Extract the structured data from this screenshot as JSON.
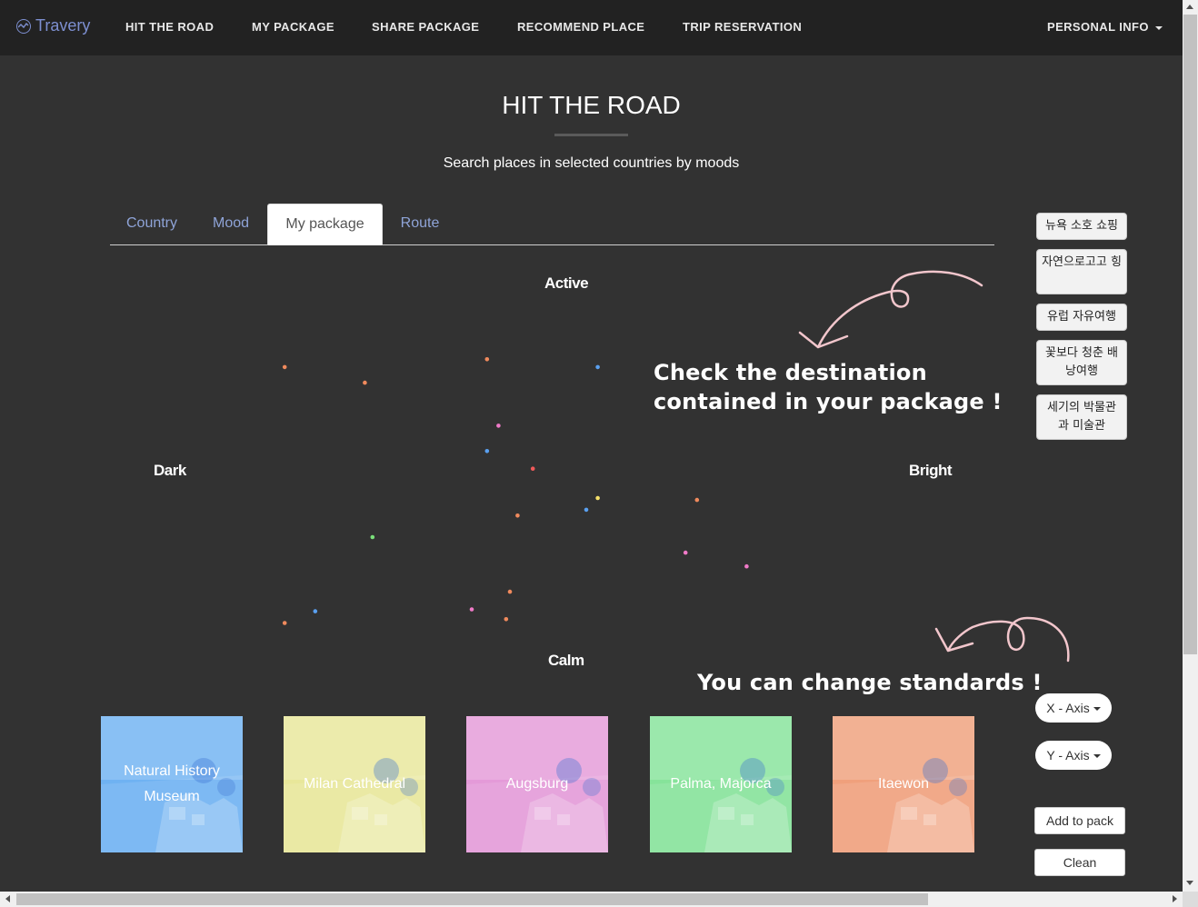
{
  "nav": {
    "brand": "Travery",
    "items": [
      "HIT THE ROAD",
      "MY PACKAGE",
      "SHARE PACKAGE",
      "RECOMMEND PLACE",
      "TRIP RESERVATION"
    ],
    "personal": "PERSONAL INFO"
  },
  "header": {
    "title": "HIT THE ROAD",
    "subtitle": "Search places in selected countries by moods"
  },
  "tabs": [
    "Country",
    "Mood",
    "My package",
    "Route"
  ],
  "active_tab": "My package",
  "axes": {
    "top": "Active",
    "bottom": "Calm",
    "left": "Dark",
    "right": "Bright"
  },
  "notes": {
    "check_line1": "Check the destination",
    "check_line2": "contained in your package !",
    "change": "You can change standards !"
  },
  "packages": [
    "뉴욕 소호 쇼핑",
    "자연으로고고 힝",
    "유럽 자유여행",
    "꽃보다 청춘 배 낭여행",
    "세기의 박물관 과 미술관"
  ],
  "controls": {
    "x_axis": "X - Axis",
    "y_axis": "Y - Axis",
    "add": "Add to pack",
    "clean": "Clean"
  },
  "cards": [
    {
      "label": "Natural History Museum",
      "color": "#6fb2f2"
    },
    {
      "label": "Milan Cathedral",
      "color": "#e8e79a"
    },
    {
      "label": "Augsburg",
      "color": "#e49ad8"
    },
    {
      "label": "Palma, Majorca",
      "color": "#86e39a"
    },
    {
      "label": "Itaewon",
      "color": "#f0a07c"
    }
  ],
  "chart_data": {
    "type": "scatter",
    "x_neg": "Dark",
    "x_pos": "Bright",
    "y_pos": "Active",
    "y_neg": "Calm",
    "xlim": [
      -1,
      1
    ],
    "ylim": [
      -1,
      1
    ],
    "points": [
      {
        "x": -0.74,
        "y": 0.54,
        "color": "#f08a5d"
      },
      {
        "x": -0.53,
        "y": 0.46,
        "color": "#f08a5d"
      },
      {
        "x": -0.21,
        "y": 0.58,
        "color": "#f08a5d"
      },
      {
        "x": 0.08,
        "y": 0.54,
        "color": "#5aa0f0"
      },
      {
        "x": -0.18,
        "y": 0.24,
        "color": "#f07ac8"
      },
      {
        "x": -0.21,
        "y": 0.11,
        "color": "#5aa0f0"
      },
      {
        "x": -0.09,
        "y": 0.02,
        "color": "#f05a5a"
      },
      {
        "x": 0.08,
        "y": -0.13,
        "color": "#f5e06a"
      },
      {
        "x": 0.05,
        "y": -0.19,
        "color": "#5aa0f0"
      },
      {
        "x": -0.13,
        "y": -0.22,
        "color": "#f08a5d"
      },
      {
        "x": 0.34,
        "y": -0.14,
        "color": "#f08a5d"
      },
      {
        "x": -0.51,
        "y": -0.33,
        "color": "#7ae07a"
      },
      {
        "x": 0.31,
        "y": -0.41,
        "color": "#f07ac8"
      },
      {
        "x": 0.47,
        "y": -0.48,
        "color": "#f07ac8"
      },
      {
        "x": -0.15,
        "y": -0.61,
        "color": "#f08a5d"
      },
      {
        "x": -0.25,
        "y": -0.7,
        "color": "#f07ac8"
      },
      {
        "x": -0.16,
        "y": -0.75,
        "color": "#f08a5d"
      },
      {
        "x": -0.66,
        "y": -0.71,
        "color": "#5aa0f0"
      },
      {
        "x": -0.74,
        "y": -0.77,
        "color": "#f08a5d"
      }
    ]
  }
}
